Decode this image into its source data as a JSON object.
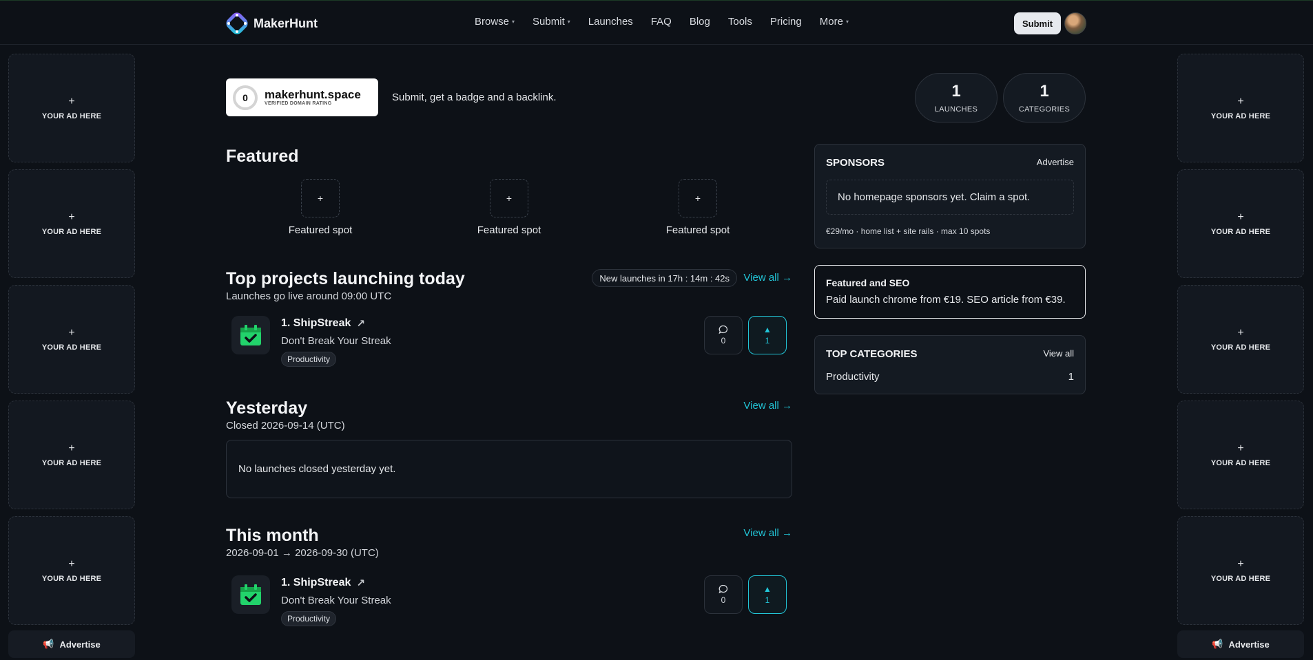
{
  "app": {
    "name": "MakerHunt"
  },
  "nav": {
    "items": [
      {
        "label": "Browse",
        "dropdown": true
      },
      {
        "label": "Submit",
        "dropdown": true
      },
      {
        "label": "Launches",
        "dropdown": false
      },
      {
        "label": "FAQ",
        "dropdown": false
      },
      {
        "label": "Blog",
        "dropdown": false
      },
      {
        "label": "Tools",
        "dropdown": false
      },
      {
        "label": "Pricing",
        "dropdown": false
      },
      {
        "label": "More",
        "dropdown": true
      }
    ],
    "submit_label": "Submit"
  },
  "ads": {
    "slot_label": "YOUR AD HERE",
    "plus": "+",
    "advertise_label": "Advertise"
  },
  "badge": {
    "rating": "0",
    "domain": "makerhunt.space",
    "subtitle": "VERIFIED DOMAIN RATING",
    "tagline": "Submit, get a badge and a backlink."
  },
  "stats": [
    {
      "value": "1",
      "label": "LAUNCHES"
    },
    {
      "value": "1",
      "label": "CATEGORIES"
    }
  ],
  "featured": {
    "title": "Featured",
    "spots": [
      {
        "label": "Featured spot"
      },
      {
        "label": "Featured spot"
      },
      {
        "label": "Featured spot"
      }
    ],
    "plus": "+"
  },
  "today": {
    "title": "Top projects launching today",
    "subtitle": "Launches go live around 09:00 UTC",
    "countdown": "New launches in 17h : 14m : 42s",
    "view_all": "View all →",
    "launches": [
      {
        "rank_name": "1. ShipStreak",
        "tagline": "Don't Break Your Streak",
        "tag": "Productivity",
        "comments": "0",
        "votes": "1"
      }
    ]
  },
  "yesterday": {
    "title": "Yesterday",
    "subtitle": "Closed 2026-09-14 (UTC)",
    "view_all": "View all →",
    "empty": "No launches closed yesterday yet."
  },
  "month": {
    "title": "This month",
    "subtitle": "2026-09-01 → 2026-09-30 (UTC)",
    "view_all": "View all →",
    "launches": [
      {
        "rank_name": "1. ShipStreak",
        "tagline": "Don't Break Your Streak",
        "tag": "Productivity",
        "comments": "0",
        "votes": "1"
      }
    ]
  },
  "sponsors": {
    "title": "SPONSORS",
    "advertise": "Advertise",
    "empty": "No homepage sponsors yet. Claim a spot.",
    "footer": "€29/mo · home list + site rails · max 10 spots"
  },
  "seo": {
    "title": "Featured and SEO",
    "text": "Paid launch chrome from €19. SEO article from €39."
  },
  "top_categories": {
    "title": "TOP CATEGORIES",
    "view_all": "View all",
    "items": [
      {
        "name": "Productivity",
        "count": "1"
      }
    ]
  },
  "colors": {
    "accent": "#22c6d8",
    "background": "#0d1117",
    "icon_green": "#22d36b"
  }
}
